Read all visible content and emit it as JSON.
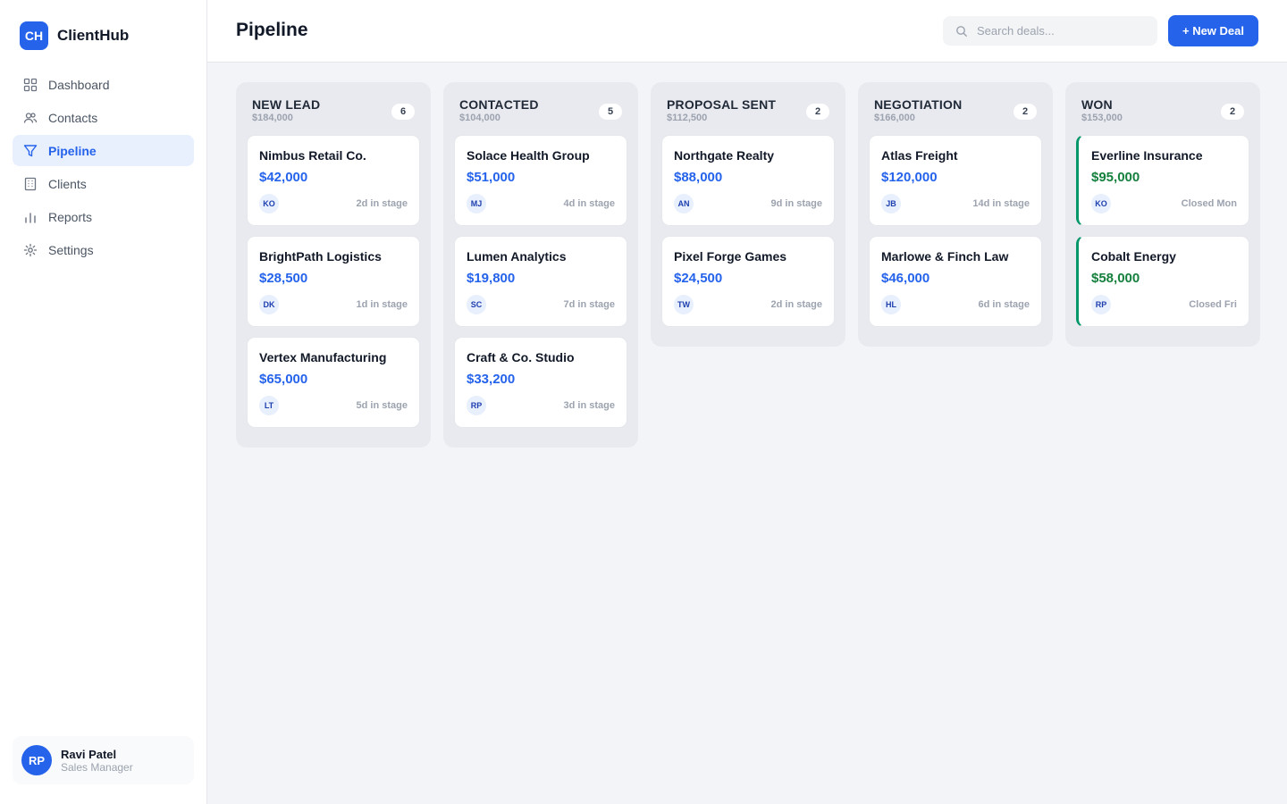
{
  "brand": {
    "logo": "CH",
    "name": "ClientHub"
  },
  "sidebar": {
    "items": [
      {
        "label": "Dashboard",
        "icon": "grid-icon",
        "active": false
      },
      {
        "label": "Contacts",
        "icon": "users-icon",
        "active": false
      },
      {
        "label": "Pipeline",
        "icon": "filter-icon",
        "active": true
      },
      {
        "label": "Clients",
        "icon": "building-icon",
        "active": false
      },
      {
        "label": "Reports",
        "icon": "bar-chart-icon",
        "active": false
      },
      {
        "label": "Settings",
        "icon": "gear-icon",
        "active": false
      }
    ]
  },
  "user": {
    "initials": "RP",
    "name": "Ravi Patel",
    "role": "Sales Manager"
  },
  "header": {
    "title": "Pipeline",
    "search_placeholder": "Search deals...",
    "new_deal_label": "+ New Deal"
  },
  "colors": {
    "accent": "#2563eb",
    "won": "#15803d",
    "won_border": "#059669"
  },
  "columns": [
    {
      "title": "NEW LEAD",
      "total": "$184,000",
      "count": "6",
      "cards": [
        {
          "name": "Nimbus Retail Co.",
          "value": "$42,000",
          "owner": "KO",
          "meta": "2d in stage"
        },
        {
          "name": "BrightPath Logistics",
          "value": "$28,500",
          "owner": "DK",
          "meta": "1d in stage"
        },
        {
          "name": "Vertex Manufacturing",
          "value": "$65,000",
          "owner": "LT",
          "meta": "5d in stage"
        }
      ]
    },
    {
      "title": "CONTACTED",
      "total": "$104,000",
      "count": "5",
      "cards": [
        {
          "name": "Solace Health Group",
          "value": "$51,000",
          "owner": "MJ",
          "meta": "4d in stage"
        },
        {
          "name": "Lumen Analytics",
          "value": "$19,800",
          "owner": "SC",
          "meta": "7d in stage"
        },
        {
          "name": "Craft & Co. Studio",
          "value": "$33,200",
          "owner": "RP",
          "meta": "3d in stage"
        }
      ]
    },
    {
      "title": "PROPOSAL SENT",
      "total": "$112,500",
      "count": "2",
      "cards": [
        {
          "name": "Northgate Realty",
          "value": "$88,000",
          "owner": "AN",
          "meta": "9d in stage"
        },
        {
          "name": "Pixel Forge Games",
          "value": "$24,500",
          "owner": "TW",
          "meta": "2d in stage"
        }
      ]
    },
    {
      "title": "NEGOTIATION",
      "total": "$166,000",
      "count": "2",
      "cards": [
        {
          "name": "Atlas Freight",
          "value": "$120,000",
          "owner": "JB",
          "meta": "14d in stage"
        },
        {
          "name": "Marlowe & Finch Law",
          "value": "$46,000",
          "owner": "HL",
          "meta": "6d in stage"
        }
      ]
    },
    {
      "title": "WON",
      "total": "$153,000",
      "count": "2",
      "won": true,
      "cards": [
        {
          "name": "Everline Insurance",
          "value": "$95,000",
          "owner": "KO",
          "meta": "Closed Mon"
        },
        {
          "name": "Cobalt Energy",
          "value": "$58,000",
          "owner": "RP",
          "meta": "Closed Fri"
        }
      ]
    }
  ]
}
